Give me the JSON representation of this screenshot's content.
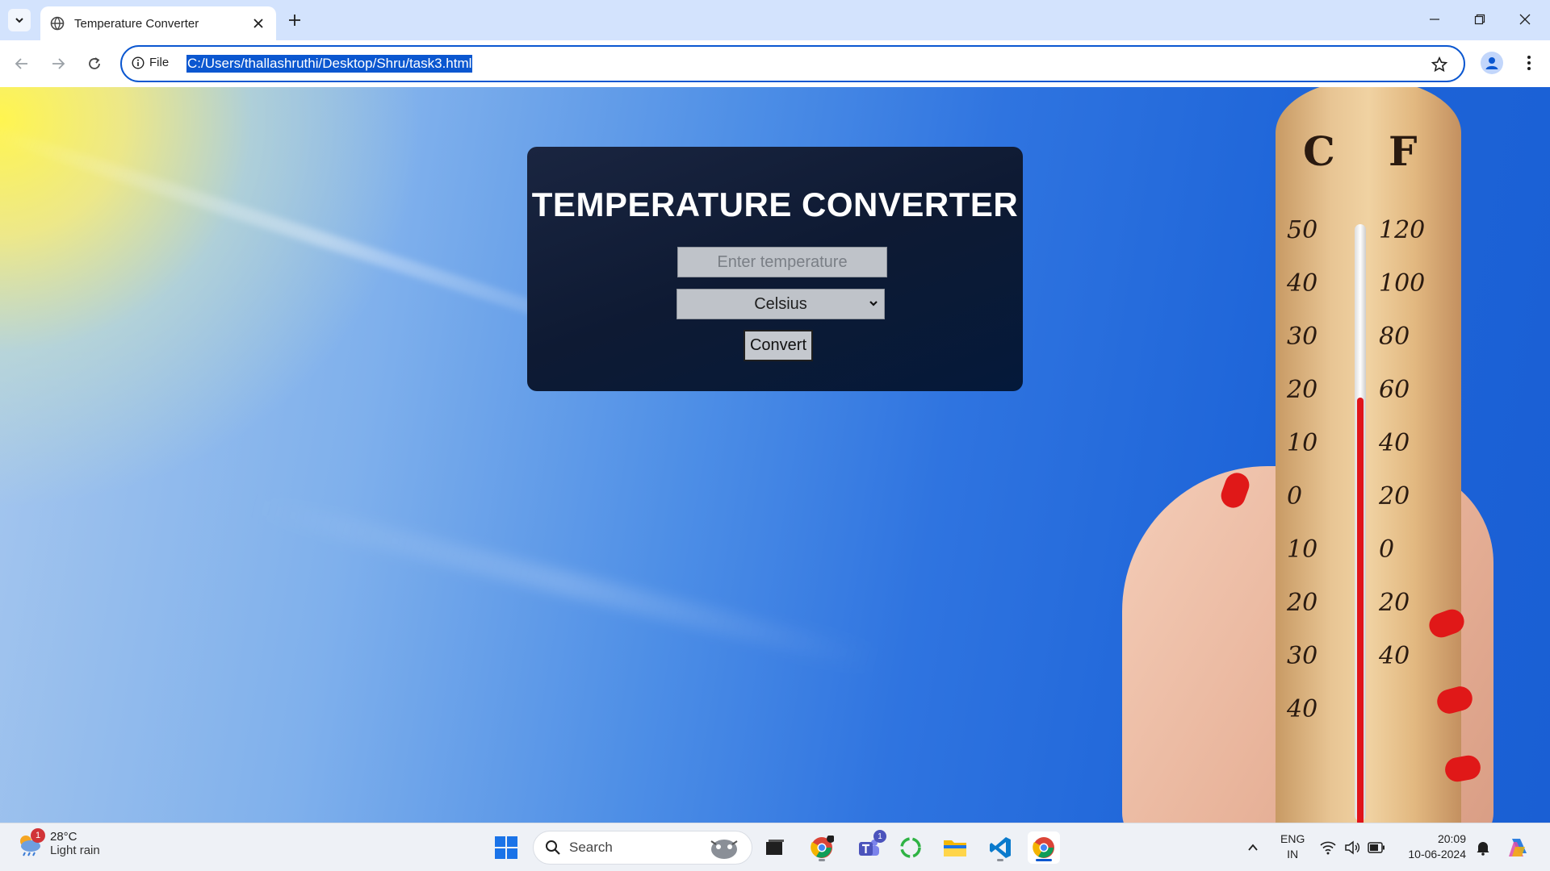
{
  "browser": {
    "tab_title": "Temperature Converter",
    "omnibox_scheme_label": "File",
    "url": "C:/Users/thallashruthi/Desktop/Shru/task3.html"
  },
  "page": {
    "heading": "TEMPERATURE CONVERTER",
    "temperature_input": {
      "placeholder": "Enter temperature",
      "value": ""
    },
    "unit_select": {
      "selected": "Celsius"
    },
    "convert_label": "Convert"
  },
  "thermometer": {
    "celsius_label": "C",
    "fahrenheit_label": "F",
    "celsius_ticks": [
      "50",
      "40",
      "30",
      "20",
      "10",
      "0",
      "10",
      "20",
      "30",
      "40"
    ],
    "fahrenheit_ticks": [
      "120",
      "100",
      "80",
      "60",
      "40",
      "20",
      "0",
      "20",
      "40"
    ]
  },
  "taskbar": {
    "weather": {
      "temp": "28°C",
      "condition": "Light rain",
      "badge": "1"
    },
    "search_label": "Search",
    "teams_badge": "1",
    "lang_primary": "ENG",
    "lang_secondary": "IN",
    "time": "20:09",
    "date": "10-06-2024"
  },
  "colors": {
    "accent": "#0b57d0",
    "card_bg": "#0e1a33",
    "mercury": "#e0141b"
  }
}
